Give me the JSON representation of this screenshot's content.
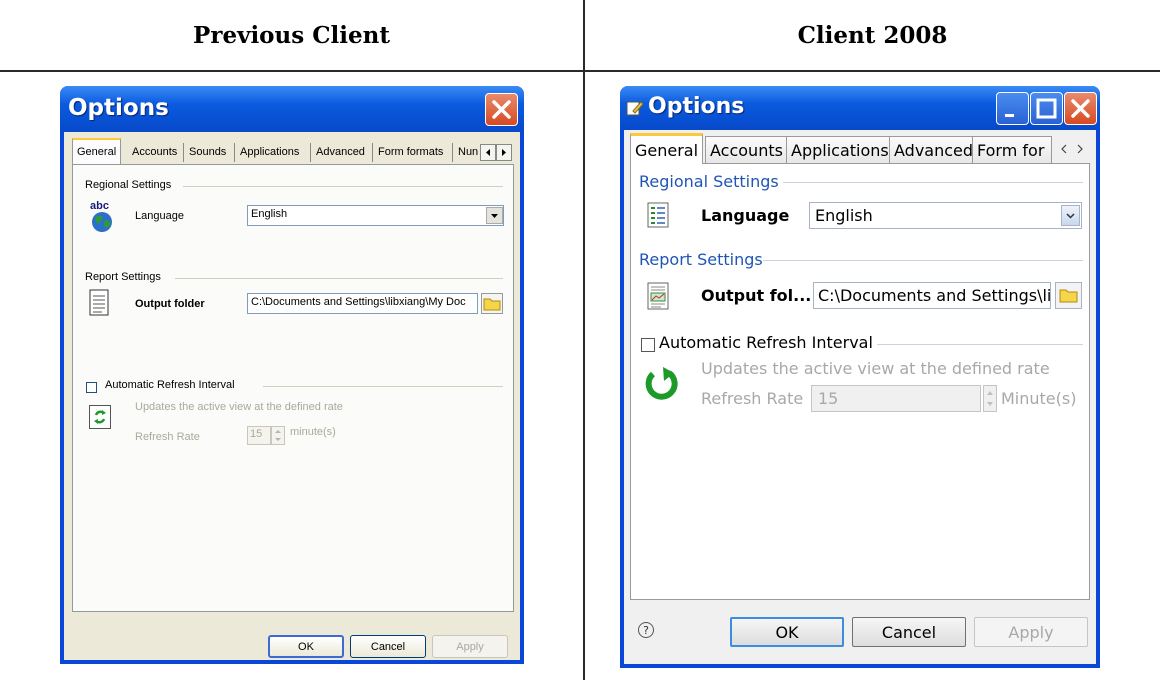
{
  "comparison": {
    "left_header": "Previous Client",
    "right_header": "Client 2008"
  },
  "previous_client": {
    "title": "Options",
    "tabs": [
      "General",
      "Accounts",
      "Sounds",
      "Applications",
      "Advanced",
      "Form formats",
      "Nun"
    ],
    "regional_settings": "Regional Settings",
    "language_label": "Language",
    "language_value": "English",
    "report_settings": "Report Settings",
    "output_folder_label": "Output folder",
    "output_folder_value": "C:\\Documents and Settings\\libxiang\\My Doc",
    "auto_refresh_label": "Automatic Refresh Interval",
    "auto_refresh_desc": "Updates the active view at the defined rate",
    "refresh_rate_label": "Refresh Rate",
    "refresh_rate_value": "15",
    "refresh_unit": "minute(s)",
    "ok": "OK",
    "cancel": "Cancel",
    "apply": "Apply",
    "icons": {
      "globe": "globe-icon",
      "document": "document-icon",
      "refresh": "refresh-icon",
      "folder": "folder-icon",
      "close": "close-icon"
    }
  },
  "client_2008": {
    "title": "Options",
    "tabs": [
      "General",
      "Accounts",
      "Applications",
      "Advanced",
      "Form for"
    ],
    "regional_settings": "Regional Settings",
    "language_label": "Language",
    "language_value": "English",
    "report_settings": "Report Settings",
    "output_folder_label": "Output fol...",
    "output_folder_value": "C:\\Documents and Settings\\lib",
    "auto_refresh_label": "Automatic Refresh Interval",
    "auto_refresh_desc": "Updates the active view at the defined rate",
    "refresh_rate_label": "Refresh Rate",
    "refresh_rate_value": "15",
    "refresh_unit": "Minute(s)",
    "help": "?",
    "ok": "OK",
    "cancel": "Cancel",
    "apply": "Apply",
    "colors": {
      "accent": "#1f56b4",
      "refresh_green": "#1d9a2a"
    }
  }
}
